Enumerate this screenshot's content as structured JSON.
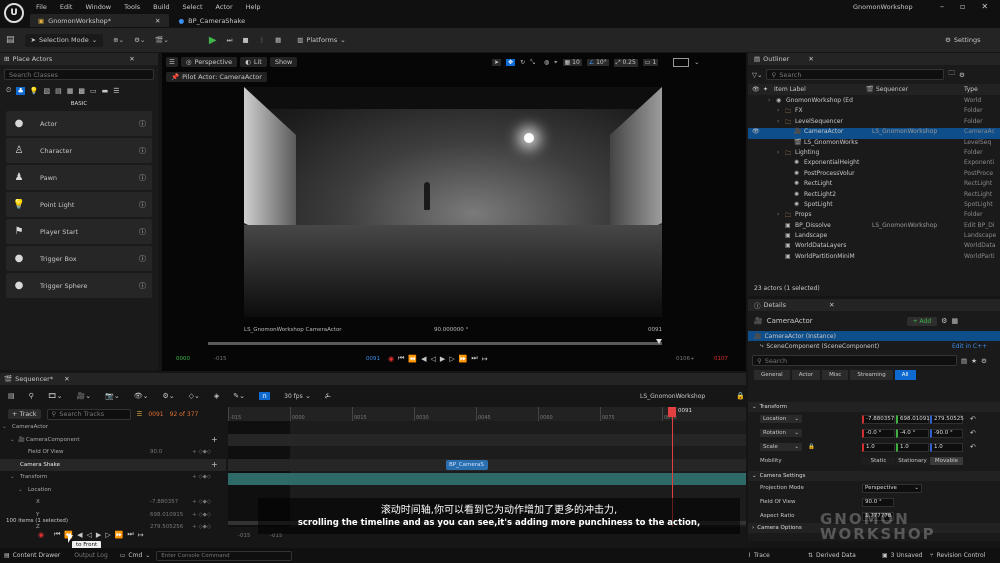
{
  "menu": {
    "items": [
      "File",
      "Edit",
      "Window",
      "Tools",
      "Build",
      "Select",
      "Actor",
      "Help"
    ],
    "project": "GnomonWorkshop"
  },
  "tabs": [
    {
      "label": "GnomonWorkshop*"
    },
    {
      "label": "BP_CameraShake"
    }
  ],
  "toolbar": {
    "selection_mode": "Selection Mode",
    "platforms": "Platforms",
    "settings": "Settings"
  },
  "place_actors": {
    "title": "Place Actors",
    "search_placeholder": "Search Classes",
    "category": "BASIC",
    "items": [
      {
        "label": "Actor",
        "icon": "sphere-icon"
      },
      {
        "label": "Character",
        "icon": "character-icon"
      },
      {
        "label": "Pawn",
        "icon": "pawn-icon"
      },
      {
        "label": "Point Light",
        "icon": "light-bulb-icon"
      },
      {
        "label": "Player Start",
        "icon": "flag-icon"
      },
      {
        "label": "Trigger Box",
        "icon": "sphere-icon"
      },
      {
        "label": "Trigger Sphere",
        "icon": "sphere-icon"
      }
    ]
  },
  "viewport": {
    "perspective": "Perspective",
    "lit": "Lit",
    "show": "Show",
    "pilot": "Pilot Actor: CameraActor",
    "grid": "10",
    "angle": "10°",
    "scale": "0.25",
    "cams": "1",
    "overlay_left": "LS_GnomonWorkshop CameraActor",
    "overlay_center": "90.000000 °",
    "overlay_right": "0091",
    "time_start": "0000",
    "time_start2": "-015",
    "time_cur": "0091",
    "time_end": "0106+",
    "time_end2": "0107"
  },
  "outliner": {
    "title": "Outliner",
    "search_placeholder": "Search",
    "col_label": "Item Label",
    "col_seq": "Sequencer",
    "col_type": "Type",
    "footer": "23 actors (1 selected)",
    "rows": [
      {
        "label": "GnomonWorkshop (Ed",
        "seq": "",
        "type": "World",
        "indent": 0,
        "icon": "world"
      },
      {
        "label": "FX",
        "seq": "",
        "type": "Folder",
        "indent": 1,
        "icon": "folder"
      },
      {
        "label": "LevelSequencer",
        "seq": "",
        "type": "Folder",
        "indent": 1,
        "icon": "folder"
      },
      {
        "label": "CameraActor",
        "seq": "LS_GnomonWorkshop",
        "type": "CameraAc",
        "indent": 2,
        "icon": "camera",
        "selected": true
      },
      {
        "label": "LS_GnomonWorks",
        "seq": "",
        "type": "LevelSeq",
        "indent": 2,
        "icon": "seq"
      },
      {
        "label": "Lighting",
        "seq": "",
        "type": "Folder",
        "indent": 1,
        "icon": "folder"
      },
      {
        "label": "ExponentialHeight",
        "seq": "",
        "type": "Exponenti",
        "indent": 2,
        "icon": "light"
      },
      {
        "label": "PostProcessVolur",
        "seq": "",
        "type": "PostProce",
        "indent": 2,
        "icon": "light"
      },
      {
        "label": "RectLight",
        "seq": "",
        "type": "RectLight",
        "indent": 2,
        "icon": "light"
      },
      {
        "label": "RectLight2",
        "seq": "",
        "type": "RectLight",
        "indent": 2,
        "icon": "light"
      },
      {
        "label": "SpotLight",
        "seq": "",
        "type": "SpotLight",
        "indent": 2,
        "icon": "light"
      },
      {
        "label": "Props",
        "seq": "",
        "type": "Folder",
        "indent": 1,
        "icon": "folder"
      },
      {
        "label": "BP_Dissolve",
        "seq": "LS_GnomonWorkshop",
        "type": "Edit BP_Di",
        "indent": 1,
        "icon": "actor",
        "link": true
      },
      {
        "label": "Landscape",
        "seq": "",
        "type": "Landscape",
        "indent": 1,
        "icon": "actor"
      },
      {
        "label": "WorldDataLayers",
        "seq": "",
        "type": "WorldData",
        "indent": 1,
        "icon": "actor"
      },
      {
        "label": "WorldPartitionMiniM",
        "seq": "",
        "type": "WorldParti",
        "indent": 1,
        "icon": "actor"
      }
    ]
  },
  "details": {
    "title": "Details",
    "actor": "CameraActor",
    "add": "+ Add",
    "instance": "CameraActor (Instance)",
    "component": "SceneComponent (SceneComponent)",
    "edit_cpp": "Edit in C++",
    "search_placeholder": "Search",
    "tabs": [
      "General",
      "Actor",
      "Misc",
      "Streaming",
      "All"
    ],
    "transform_title": "Transform",
    "location_label": "Location",
    "location": [
      "-7.880357",
      "698.01091",
      "279.50525"
    ],
    "rotation_label": "Rotation",
    "rotation": [
      "-0.0 °",
      "-4.0 °",
      "-90.0 °"
    ],
    "scale_label": "Scale",
    "scale": [
      "1.0",
      "1.0",
      "1.0"
    ],
    "mobility_label": "Mobility",
    "mobility": [
      "Static",
      "Stationary",
      "Movable"
    ],
    "camera_settings": "Camera Settings",
    "projection_label": "Projection Mode",
    "projection": "Perspective",
    "fov_label": "Field Of View",
    "fov": "90.0 °",
    "aspect_label": "Aspect Ratio",
    "aspect": "1.777778",
    "camera_options": "Camera Options"
  },
  "sequencer": {
    "tab": "Sequencer*",
    "fps": "30 fps",
    "seq_name": "LS_GnomonWorkshop",
    "track": "+ Track",
    "search_placeholder": "Search Tracks",
    "frame": "0091",
    "frame_of": "92 of 377",
    "tracks": [
      {
        "label": "CameraActor",
        "indent": 0
      },
      {
        "label": "CameraComponent",
        "indent": 1
      },
      {
        "label": "Field Of View",
        "indent": 2,
        "value": "90.0"
      },
      {
        "label": "Camera Shake",
        "indent": 1
      },
      {
        "label": "Transform",
        "indent": 1
      },
      {
        "label": "Location",
        "indent": 2
      },
      {
        "label": "X",
        "indent": 3,
        "value": "-7.880357"
      },
      {
        "label": "Y",
        "indent": 3,
        "value": "698.010915"
      },
      {
        "label": "Z",
        "indent": 3,
        "value": "279.505256"
      }
    ],
    "ruler": [
      "-015",
      "0000",
      "0015",
      "0030",
      "0045",
      "0060",
      "0075",
      "0090"
    ],
    "cursor": "0091",
    "clip": "BP_CameraS",
    "items_count": "100 items (1 selected)",
    "start": "-015",
    "end": "-015"
  },
  "subtitles": {
    "zh": "滚动时间轴,你可以看到它为动作增加了更多的冲击力,",
    "en": "scrolling the timeline and as you can see,it's adding more punchiness to the action,"
  },
  "tooltip": "to Front",
  "statusbar": {
    "content_drawer": "Content Drawer",
    "output_log": "Output Log",
    "cmd": "Cmd",
    "console_placeholder": "Enter Console Command",
    "trace": "Trace",
    "derived": "Derived Data",
    "unsaved": "3 Unsaved",
    "revision": "Revision Control"
  },
  "watermark": "GNOMON WORKSHOP"
}
